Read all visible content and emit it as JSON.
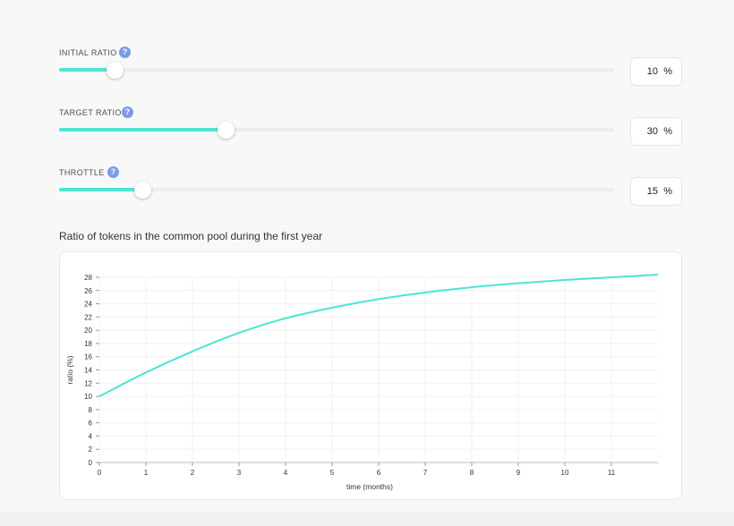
{
  "controls": [
    {
      "label": "INITIAL RATIO",
      "value": 10,
      "unit": "%",
      "help": "?"
    },
    {
      "label": "TARGET RATIO",
      "value": 30,
      "unit": "%",
      "help": "?"
    },
    {
      "label": "THROTTLE",
      "value": 15,
      "unit": "%",
      "help": "?"
    }
  ],
  "chart_title": "Ratio of tokens in the common pool during the first year",
  "colors": {
    "accent": "#4ee3d4",
    "help": "#7a9be8"
  },
  "chart_data": {
    "type": "line",
    "xlabel": "time (months)",
    "ylabel": "ratio (%)",
    "xlim": [
      0,
      12
    ],
    "ylim": [
      0,
      28
    ],
    "x_ticks": [
      0,
      1,
      2,
      3,
      4,
      5,
      6,
      7,
      8,
      9,
      10,
      11
    ],
    "y_ticks": [
      0,
      2,
      4,
      6,
      8,
      10,
      12,
      14,
      16,
      18,
      20,
      22,
      24,
      26,
      28
    ],
    "grid": true,
    "series": [
      {
        "color": "#4ee3d4",
        "x": [
          0,
          1,
          2,
          3,
          4,
          5,
          6,
          7,
          8,
          9,
          10,
          11,
          12
        ],
        "y": [
          10,
          13.6,
          16.8,
          19.6,
          21.8,
          23.4,
          24.7,
          25.7,
          26.5,
          27.1,
          27.6,
          28.0,
          28.4
        ]
      }
    ]
  }
}
